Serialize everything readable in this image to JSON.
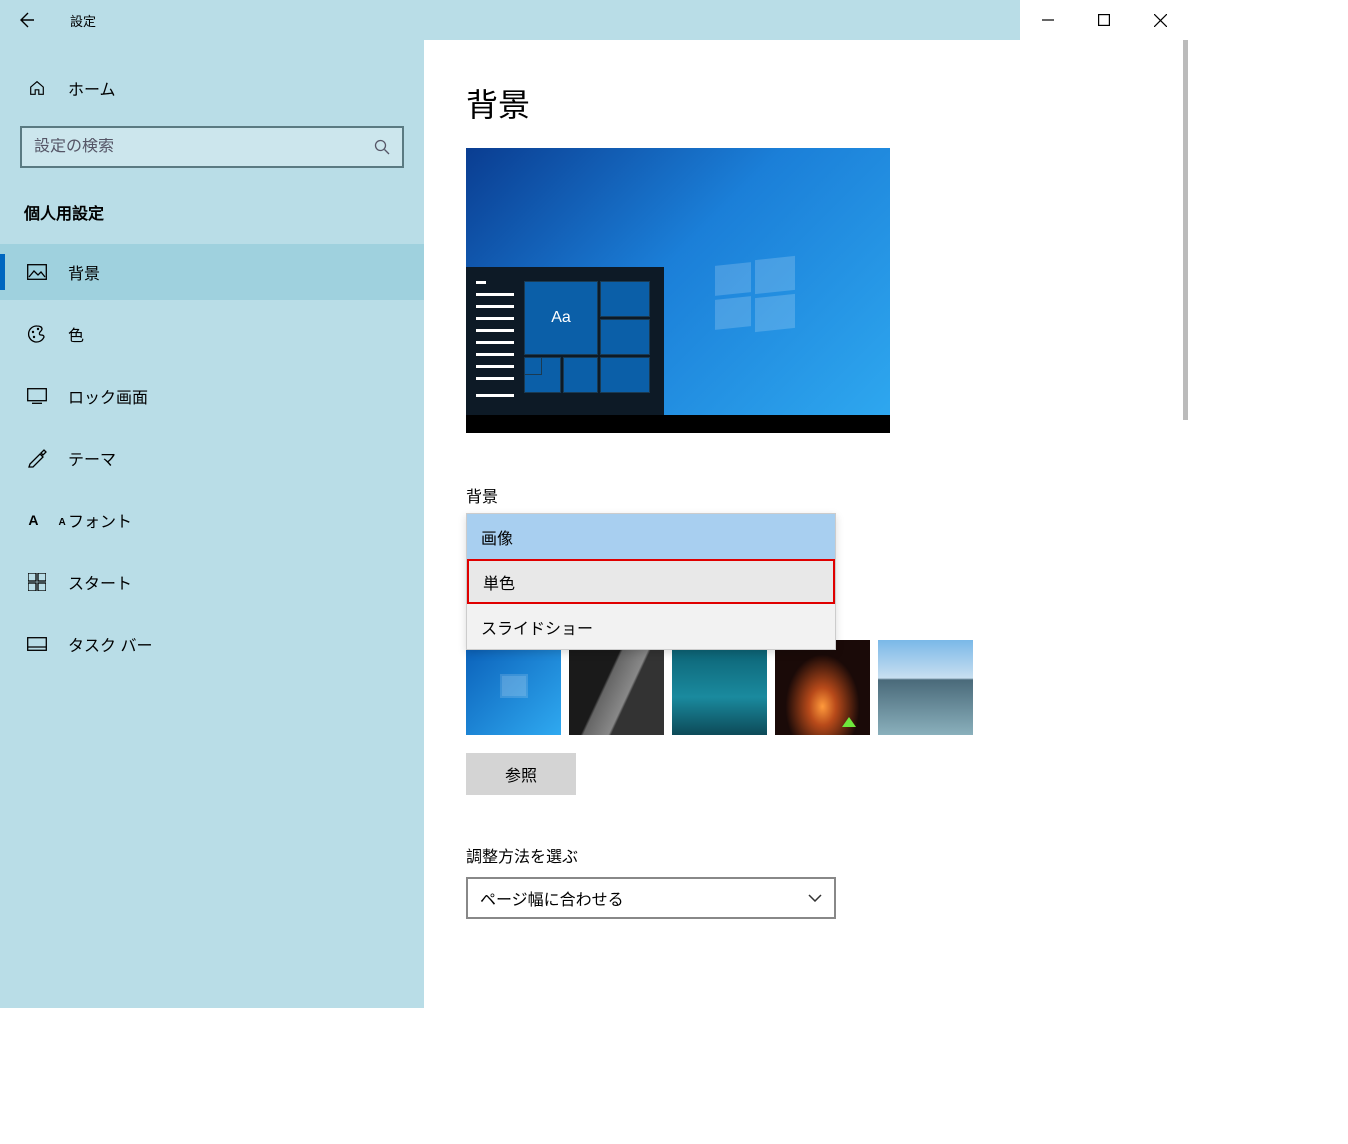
{
  "titlebar": {
    "title": "設定"
  },
  "sidebar": {
    "home": "ホーム",
    "searchPlaceholder": "設定の検索",
    "category": "個人用設定",
    "items": [
      {
        "label": "背景"
      },
      {
        "label": "色"
      },
      {
        "label": "ロック画面"
      },
      {
        "label": "テーマ"
      },
      {
        "label": "フォント"
      },
      {
        "label": "スタート"
      },
      {
        "label": "タスク バー"
      }
    ]
  },
  "content": {
    "pageTitle": "背景",
    "previewAa": "Aa",
    "backgroundLabel": "背景",
    "dropdown": {
      "options": [
        "画像",
        "単色",
        "スライドショー"
      ]
    },
    "browse": "参照",
    "fitLabel": "調整方法を選ぶ",
    "fitValue": "ページ幅に合わせる"
  }
}
